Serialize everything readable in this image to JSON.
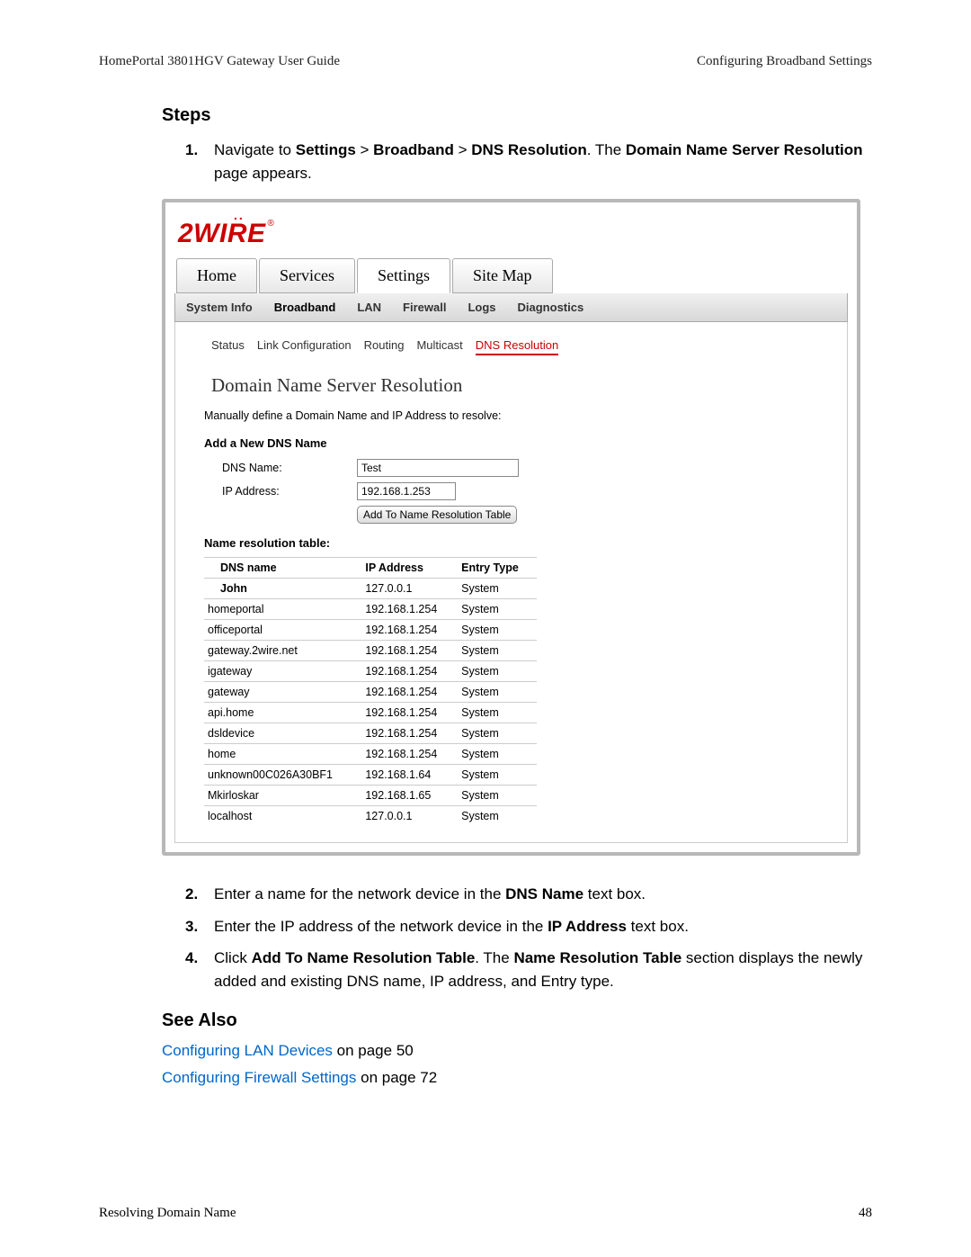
{
  "header": {
    "left": "HomePortal 3801HGV Gateway User Guide",
    "right": "Configuring Broadband Settings"
  },
  "steps_heading": "Steps",
  "steps": {
    "s1a": "Navigate to ",
    "s1b": "Settings",
    "s1c": " > ",
    "s1d": "Broadband",
    "s1e": " > ",
    "s1f": "DNS Resolution",
    "s1g": ". The ",
    "s1h": "Domain Name Server Resolution",
    "s1i": " page appears.",
    "s2a": "Enter a name for the network device in the ",
    "s2b": "DNS Name",
    "s2c": " text box.",
    "s3a": "Enter the IP address of the network device in the ",
    "s3b": "IP Address",
    "s3c": " text box.",
    "s4a": "Click ",
    "s4b": "Add To Name Resolution Table",
    "s4c": ". The ",
    "s4d": "Name Resolution Table",
    "s4e": " section displays the newly added and existing DNS name, IP address, and Entry type."
  },
  "logo_text": "2WIRE",
  "logo_reg": "®",
  "main_tabs": {
    "home": "Home",
    "services": "Services",
    "settings": "Settings",
    "sitemap": "Site Map"
  },
  "sub_tabs": {
    "sysinfo": "System Info",
    "broadband": "Broadband",
    "lan": "LAN",
    "firewall": "Firewall",
    "logs": "Logs",
    "diagnostics": "Diagnostics"
  },
  "tertiary_tabs": {
    "status": "Status",
    "linkconfig": "Link Configuration",
    "routing": "Routing",
    "multicast": "Multicast",
    "dnsres": "DNS Resolution"
  },
  "section_title": "Domain Name Server Resolution",
  "section_subtext": "Manually define a Domain Name and IP Address to resolve:",
  "add_heading": "Add a New DNS Name",
  "form": {
    "dns_label": "DNS Name:",
    "dns_value": "Test",
    "ip_label": "IP Address:",
    "ip_value": "192.168.1.253",
    "button": "Add To Name Resolution Table"
  },
  "nrt_heading": "Name resolution table:",
  "table": {
    "h1": "DNS name",
    "h2": "IP Address",
    "h3": "Entry Type",
    "rows": [
      {
        "n": "John",
        "ip": "127.0.0.1",
        "t": "System"
      },
      {
        "n": "homeportal",
        "ip": "192.168.1.254",
        "t": "System"
      },
      {
        "n": "officeportal",
        "ip": "192.168.1.254",
        "t": "System"
      },
      {
        "n": "gateway.2wire.net",
        "ip": "192.168.1.254",
        "t": "System"
      },
      {
        "n": "igateway",
        "ip": "192.168.1.254",
        "t": "System"
      },
      {
        "n": "gateway",
        "ip": "192.168.1.254",
        "t": "System"
      },
      {
        "n": "api.home",
        "ip": "192.168.1.254",
        "t": "System"
      },
      {
        "n": "dsldevice",
        "ip": "192.168.1.254",
        "t": "System"
      },
      {
        "n": "home",
        "ip": "192.168.1.254",
        "t": "System"
      },
      {
        "n": "unknown00C026A30BF1",
        "ip": "192.168.1.64",
        "t": "System"
      },
      {
        "n": "Mkirloskar",
        "ip": "192.168.1.65",
        "t": "System"
      },
      {
        "n": "localhost",
        "ip": "127.0.0.1",
        "t": "System"
      }
    ]
  },
  "see_also_heading": "See Also",
  "see_also": [
    {
      "link": "Configuring LAN Devices",
      "rest": " on page 50"
    },
    {
      "link": "Configuring Firewall Settings",
      "rest": " on page 72"
    }
  ],
  "footer": {
    "left": "Resolving Domain Name",
    "right": "48"
  }
}
